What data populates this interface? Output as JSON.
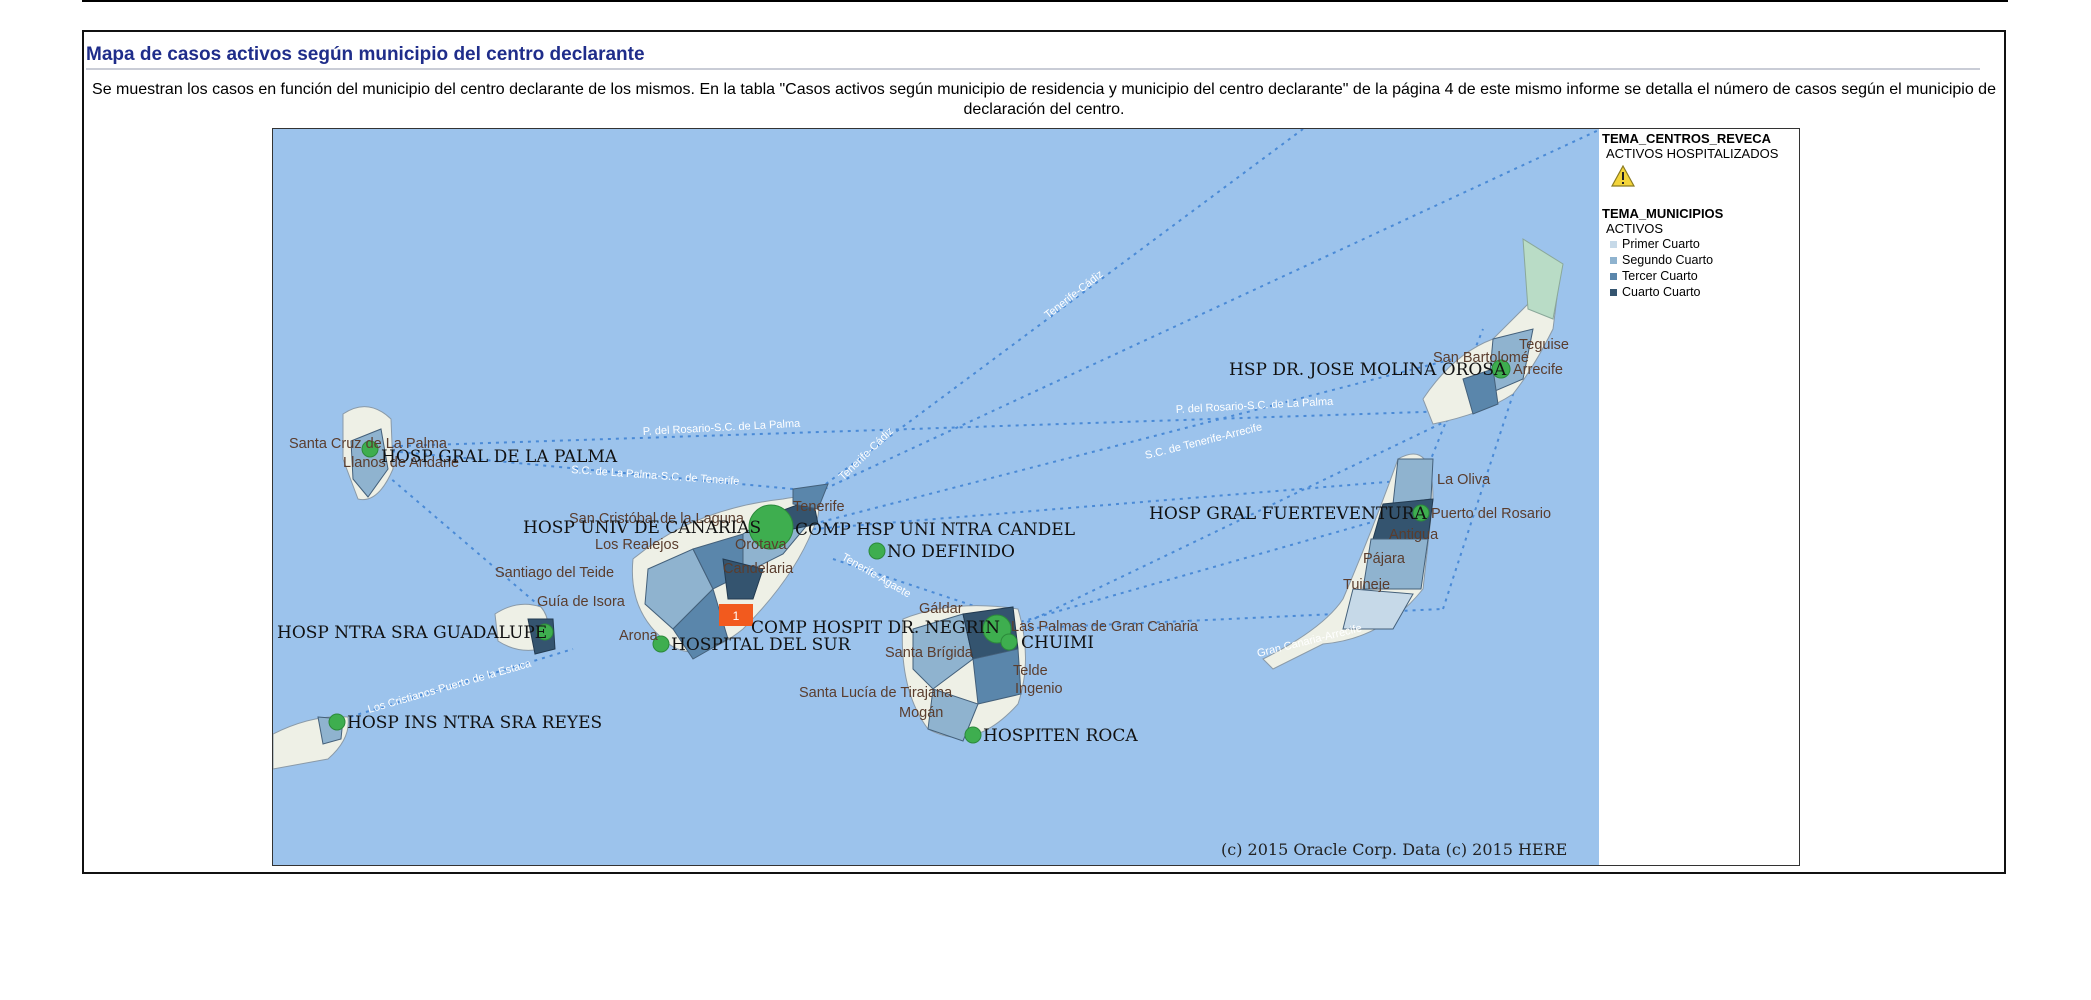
{
  "panel": {
    "title": "Mapa de casos activos según municipio del centro declarante",
    "description": "Se muestran los casos en función del municipio del centro declarante de los mismos. En la tabla \"Casos activos según municipio de residencia y municipio del centro declarante\" de la página 4 de este mismo informe se detalla el número de casos según el municipio de declaración del centro."
  },
  "map": {
    "copyright": "(c) 2015 Oracle Corp. Data (c) 2015 HERE",
    "marker_count": "1",
    "hospitals": {
      "hosp_gral_la_palma": "HOSP GRAL DE LA PALMA",
      "hosp_univ_canarias": "HOSP UNIV DE CANARIAS",
      "comp_hsp_candel": "COMP HSP UNI NTRA CANDEL",
      "no_definido": "NO DEFINIDO",
      "hosp_guadalupe": "HOSP NTRA SRA GUADALUPE",
      "hospital_del_sur": "HOSPITAL DEL SUR",
      "hosp_ins_reyes": "HOSP INS NTRA SRA REYES",
      "comp_hospit_negrin": "COMP HOSPIT DR. NEGRIN",
      "chuimi": "CHUIMI",
      "hospiten_roca": "HOSPITEN ROCA",
      "hosp_gral_fuerteventura": "HOSP GRAL FUERTEVENTURA",
      "hsp_molina_orosa": "HSP DR. JOSE MOLINA OROSA"
    },
    "towns": {
      "santa_cruz_la_palma": "Santa Cruz de La Palma",
      "los_llanos": "Llanos de Aridane",
      "san_cristobal": "San Cristóbal de la Laguna",
      "los_realejos": "Los Realejos",
      "orotava": "Orotava",
      "candelaria": "Candelaria",
      "santiago_teide": "Santiago del Teide",
      "guia_isora": "Guía de Isora",
      "arona": "Arona",
      "galdar": "Gáldar",
      "las_palmas": "Las Palmas de Gran Canaria",
      "santa_brigida": "Santa Brígida",
      "telde": "Telde",
      "santa_lucia": "Santa Lucía de Tirajana",
      "ingenio": "Ingenio",
      "mogan": "Mogán",
      "la_oliva": "La Oliva",
      "puerto_rosario": "Puerto del Rosario",
      "antigua": "Antigua",
      "pajara": "Pájara",
      "tuineje": "Tuineje",
      "teguise": "Teguise",
      "san_bartolome": "San Bartolomé",
      "arrecife": "Arrecife",
      "sc_tenerife_label": "Tenerife"
    },
    "routes": {
      "tenerife_cadiz_1": "Tenerife-Cádiz",
      "tenerife_cadiz_2": "Tenerife-Cádiz",
      "p_rosario_sc_palma_1": "P. del Rosario-S.C. de La Palma",
      "p_rosario_sc_palma_2": "P. del Rosario-S.C. de La Palma",
      "sc_palma_sc_tenerife": "S.C. de La Palma-S.C. de Tenerife",
      "sc_tenerife_arrecife": "S.C. de Tenerife-Arrecife",
      "gran_canaria_arrecife": "Gran Canaria-Arrecife",
      "tenerife_agaete": "Tenerife-Agaete",
      "los_cristianos_estaca": "Los Cristianos-Puerto de la Estaca"
    }
  },
  "legend": {
    "group1_title": "TEMA_CENTROS_REVECA",
    "group1_sub": "ACTIVOS HOSPITALIZADOS",
    "group2_title": "TEMA_MUNICIPIOS",
    "group2_sub": "ACTIVOS",
    "items": [
      {
        "label": "Primer Cuarto",
        "color": "#c6d9e8"
      },
      {
        "label": "Segundo Cuarto",
        "color": "#8fb3cf"
      },
      {
        "label": "Tercer Cuarto",
        "color": "#5a86ab"
      },
      {
        "label": "Cuarto Cuarto",
        "color": "#34546f"
      }
    ]
  },
  "colors": {
    "title": "#1f2d8a",
    "sea": "#9cc3ec",
    "hospital_dot": "#3eae4f",
    "marker": "#f25a1e"
  }
}
